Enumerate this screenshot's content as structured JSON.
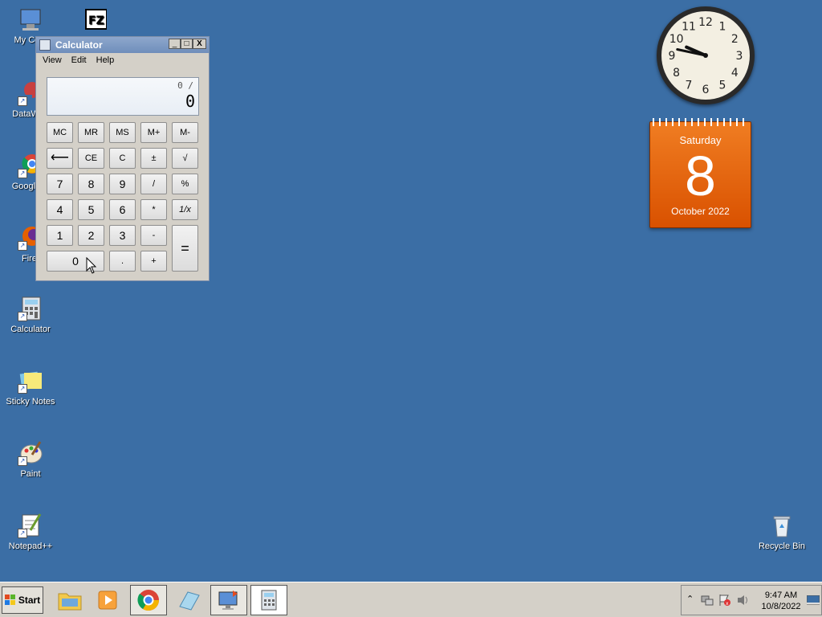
{
  "desktop": {
    "icons": [
      {
        "label": "My Computer",
        "display": "My Com"
      },
      {
        "label": "DataWa...",
        "display": "DataWag"
      },
      {
        "label": "Google Chrome",
        "display": "Google C"
      },
      {
        "label": "Firefox",
        "display": "Firef"
      },
      {
        "label": "Calculator",
        "display": "Calculator"
      },
      {
        "label": "Sticky Notes",
        "display": "Sticky Notes"
      },
      {
        "label": "Paint",
        "display": "Paint"
      },
      {
        "label": "Notepad++",
        "display": "Notepad++"
      },
      {
        "label": "Recycle Bin",
        "display": "Recycle Bin"
      }
    ],
    "filezilla_label": "FZ"
  },
  "calculator": {
    "title": "Calculator",
    "menu": [
      "View",
      "Edit",
      "Help"
    ],
    "display_expression": "0 /",
    "display_value": "0",
    "buttons": {
      "mc": "MC",
      "mr": "MR",
      "ms": "MS",
      "mplus": "M+",
      "mminus": "M-",
      "back": "⟵",
      "ce": "CE",
      "c": "C",
      "plusminus": "±",
      "sqrt": "√",
      "n7": "7",
      "n8": "8",
      "n9": "9",
      "div": "/",
      "percent": "%",
      "n4": "4",
      "n5": "5",
      "n6": "6",
      "mul": "*",
      "recip": "1/x",
      "n1": "1",
      "n2": "2",
      "n3": "3",
      "minus": "-",
      "equals": "=",
      "n0": "0",
      "dot": ".",
      "plus": "+"
    },
    "window_buttons": {
      "minimize": "_",
      "maximize": "□",
      "close": "X"
    }
  },
  "clock_gadget": {
    "numbers": [
      "12",
      "1",
      "2",
      "3",
      "4",
      "5",
      "6",
      "7",
      "8",
      "9",
      "10",
      "11"
    ]
  },
  "calendar_gadget": {
    "weekday": "Saturday",
    "day": "8",
    "month_year": "October 2022"
  },
  "taskbar": {
    "start_label": "Start",
    "apps": [
      "file-explorer",
      "media-player",
      "chrome",
      "notepad",
      "remote-desktop",
      "calculator"
    ],
    "time": "9:47 AM",
    "date": "10/8/2022"
  }
}
